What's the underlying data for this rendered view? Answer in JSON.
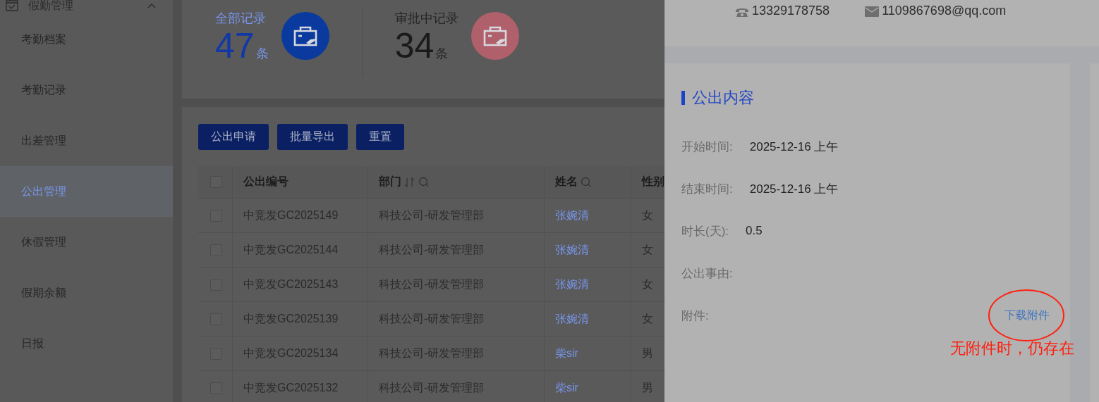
{
  "sidebar": {
    "group": {
      "label": "假勤管理",
      "expanded": true
    },
    "items": [
      {
        "label": "考勤档案",
        "selected": false
      },
      {
        "label": "考勤记录",
        "selected": false
      },
      {
        "label": "出差管理",
        "selected": false
      },
      {
        "label": "公出管理",
        "selected": true
      },
      {
        "label": "休假管理",
        "selected": false
      },
      {
        "label": "假期余额",
        "selected": false
      },
      {
        "label": "日报",
        "selected": false
      }
    ]
  },
  "stats": [
    {
      "kind": "total",
      "label": "全部记录",
      "count": "47",
      "unit": "条"
    },
    {
      "kind": "pending",
      "label": "审批中记录",
      "count": "34",
      "unit": "条"
    }
  ],
  "toolbar": [
    "公出申请",
    "批量导出",
    "重置"
  ],
  "table": {
    "select_all": {
      "checked": false
    },
    "columns": [
      {
        "label": "公出编号"
      },
      {
        "label": "部门",
        "sortable": true,
        "searchable": true
      },
      {
        "label": "姓名",
        "searchable": true
      },
      {
        "label": "性别"
      }
    ],
    "rows": [
      {
        "checked": false,
        "cells": [
          "中竞发GC2025149",
          "科技公司-研发管理部",
          "张婉清",
          "女"
        ]
      },
      {
        "checked": false,
        "cells": [
          "中竞发GC2025144",
          "科技公司-研发管理部",
          "张婉清",
          "女"
        ]
      },
      {
        "checked": false,
        "cells": [
          "中竞发GC2025143",
          "科技公司-研发管理部",
          "张婉清",
          "女"
        ]
      },
      {
        "checked": false,
        "cells": [
          "中竞发GC2025139",
          "科技公司-研发管理部",
          "张婉清",
          "女"
        ]
      },
      {
        "checked": false,
        "cells": [
          "中竞发GC2025134",
          "科技公司-研发管理部",
          "柴sir",
          "男"
        ]
      },
      {
        "checked": false,
        "cells": [
          "中竞发GC2025132",
          "科技公司-研发管理部",
          "柴sir",
          "男"
        ]
      }
    ]
  },
  "drawer": {
    "contact": {
      "phone": "13329178758",
      "email": "1109867698@qq.com"
    },
    "section_title": "公出内容",
    "fields": [
      {
        "label": "开始时间:",
        "value": "2025-12-16 上午"
      },
      {
        "label": "结束时间:",
        "value": "2025-12-16 上午"
      },
      {
        "label": "时长(天):",
        "value": "0.5"
      },
      {
        "label": "公出事由:"
      }
    ],
    "attachment": {
      "label": "附件:",
      "link": "下载附件"
    },
    "annotation": {
      "text": "无附件时，仍存在"
    }
  }
}
